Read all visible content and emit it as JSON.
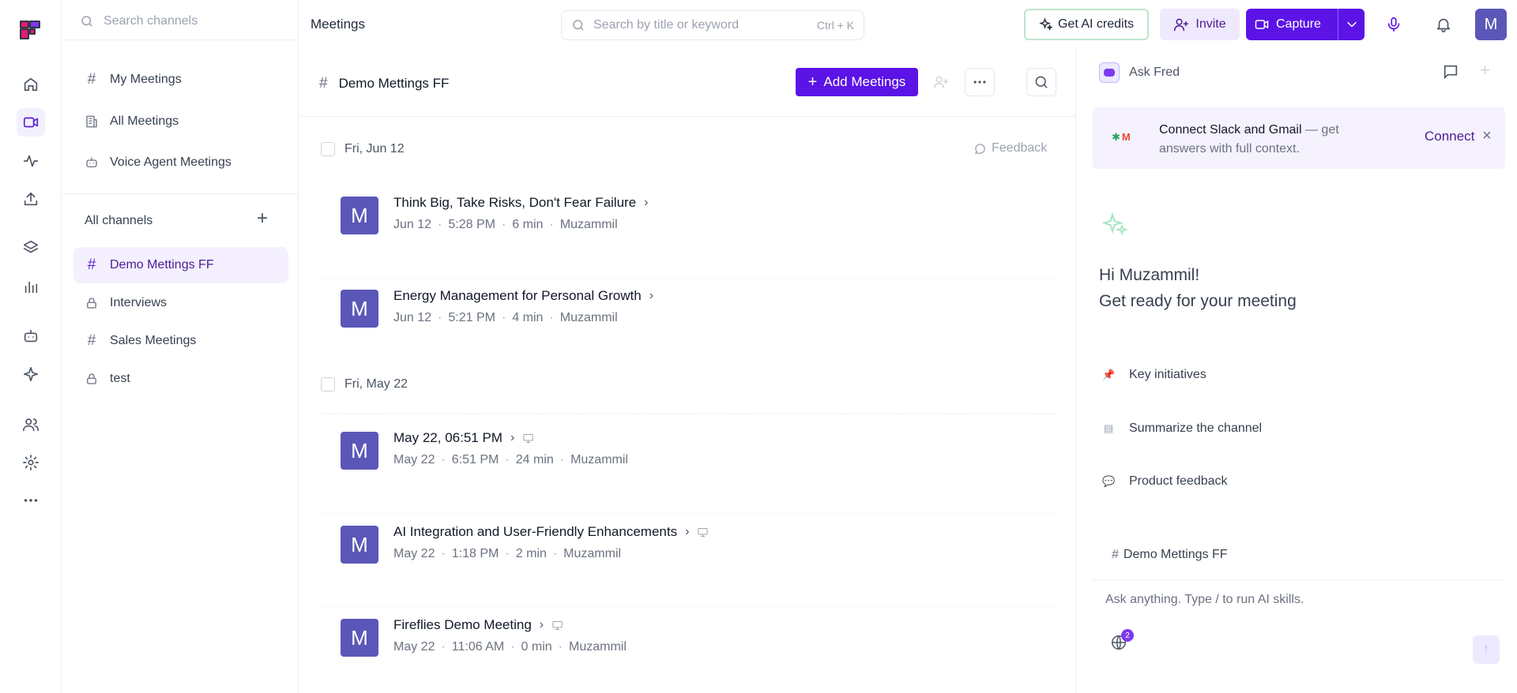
{
  "sidebar": {
    "search_placeholder": "Search channels",
    "nav": [
      {
        "label": "My Meetings"
      },
      {
        "label": "All Meetings"
      },
      {
        "label": "Voice Agent Meetings"
      }
    ],
    "all_channels_label": "All channels",
    "channels": [
      {
        "label": "Demo Mettings FF",
        "icon": "hash-icon",
        "active": true
      },
      {
        "label": "Interviews",
        "icon": "lock-icon"
      },
      {
        "label": "Sales Meetings",
        "icon": "hash-icon"
      },
      {
        "label": "test",
        "icon": "lock-icon"
      }
    ]
  },
  "header": {
    "breadcrumb": "Meetings",
    "search_placeholder": "Search by title or keyword",
    "search_shortcut": "Ctrl + K",
    "credits_label": "Get AI credits",
    "invite_label": "Invite",
    "capture_label": "Capture",
    "avatar_initial": "M"
  },
  "channel": {
    "title": "Demo Mettings FF",
    "add_label": "Add Meetings",
    "feedback_label": "Feedback",
    "groups": [
      {
        "date": "Fri, Jun 12",
        "meetings": [
          {
            "title": "Think Big, Take Risks, Don't Fear Failure",
            "date": "Jun 12",
            "time": "5:28 PM",
            "duration": "6 min",
            "owner": "Muzammil",
            "avatar": "M",
            "screen": false
          },
          {
            "title": "Energy Management for Personal Growth",
            "date": "Jun 12",
            "time": "5:21 PM",
            "duration": "4 min",
            "owner": "Muzammil",
            "avatar": "M",
            "screen": false
          }
        ]
      },
      {
        "date": "Fri, May 22",
        "meetings": [
          {
            "title": "May 22, 06:51 PM",
            "date": "May 22",
            "time": "6:51 PM",
            "duration": "24 min",
            "owner": "Muzammil",
            "avatar": "M",
            "screen": true
          },
          {
            "title": "AI Integration and User-Friendly Enhancements",
            "date": "May 22",
            "time": "1:18 PM",
            "duration": "2 min",
            "owner": "Muzammil",
            "avatar": "M",
            "screen": true
          },
          {
            "title": "Fireflies Demo Meeting",
            "date": "May 22",
            "time": "11:06 AM",
            "duration": "0 min",
            "owner": "Muzammil",
            "avatar": "M",
            "screen": true
          }
        ]
      }
    ]
  },
  "assistant": {
    "name": "Ask Fred",
    "connect_text_bold": "Connect Slack and Gmail",
    "connect_text_rest": " — get answers with full context.",
    "connect_button": "Connect",
    "greeting_line1": "Hi Muzammil!",
    "greeting_line2": "Get ready for your meeting",
    "suggestions": [
      {
        "label": "Key initiatives",
        "icon": "pin-icon"
      },
      {
        "label": "Summarize the channel",
        "icon": "document-icon"
      },
      {
        "label": "Product feedback",
        "icon": "speech-bubble-icon"
      }
    ],
    "context_channel": "Demo Mettings FF",
    "input_placeholder": "Ask anything. Type / to run AI skills.",
    "sources_count": "2"
  },
  "colors": {
    "accent": "#5b13e6",
    "avatar": "#5b57b8",
    "active_bg": "#f4f0ff"
  }
}
